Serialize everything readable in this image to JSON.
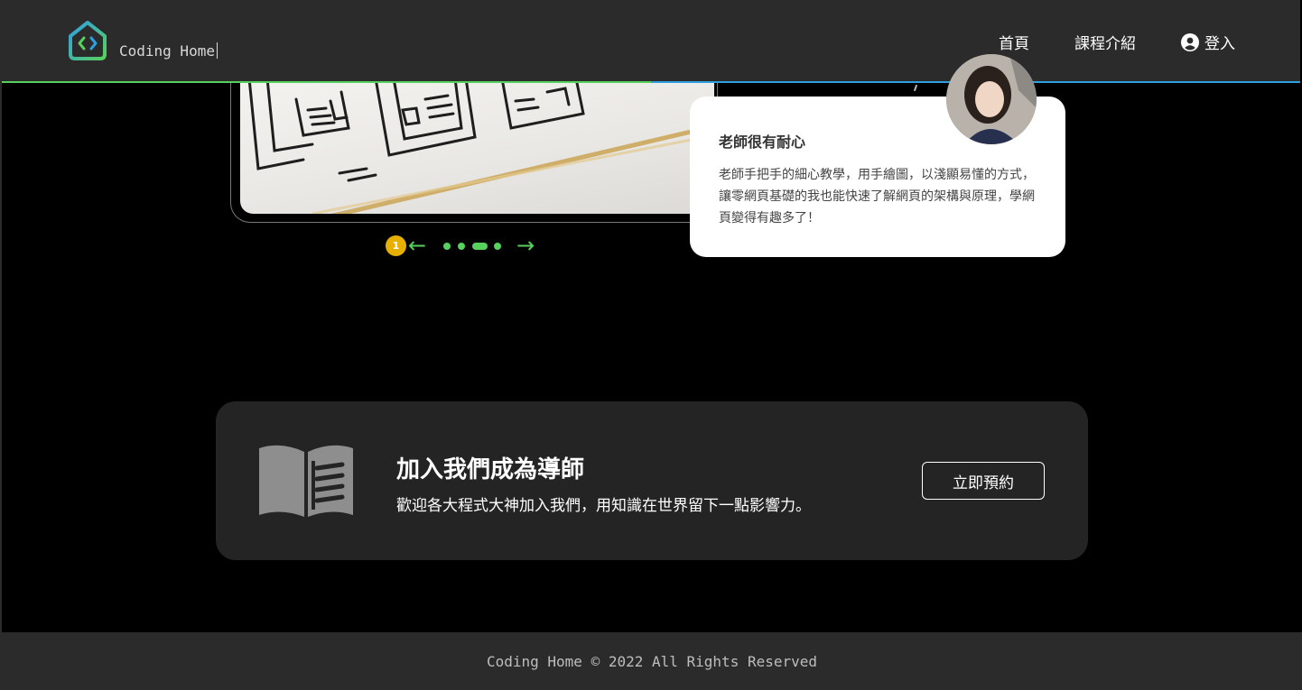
{
  "header": {
    "brand": "Coding Home",
    "nav": {
      "home": "首頁",
      "courses": "課程介紹",
      "login": "登入"
    }
  },
  "testimonial": {
    "title": "老師很有耐心",
    "body": "老師手把手的細心教學，用手繪圖，以淺顯易懂的方式，讓零網頁基礎的我也能快速了解網頁的架構與原理，學網頁變得有趣多了！"
  },
  "carousel": {
    "current_page": "1",
    "prev_icon": "arrow-left-icon",
    "next_icon": "arrow-right-icon",
    "dots": 4,
    "active_dot": 3
  },
  "cta": {
    "title": "加入我們成為導師",
    "subtitle": "歡迎各大程式大神加入我們，用知識在世界留下一點影響力。",
    "button": "立即預約",
    "icon": "book-open-icon"
  },
  "footer": {
    "copyright": "Coding Home © 2022 All Rights Reserved"
  },
  "colors": {
    "accent_green": "#57d05e",
    "accent_blue": "#2f9fe0",
    "badge_yellow": "#e7b000",
    "header_bg": "#2b2b2b",
    "banner_bg": "#242424"
  }
}
